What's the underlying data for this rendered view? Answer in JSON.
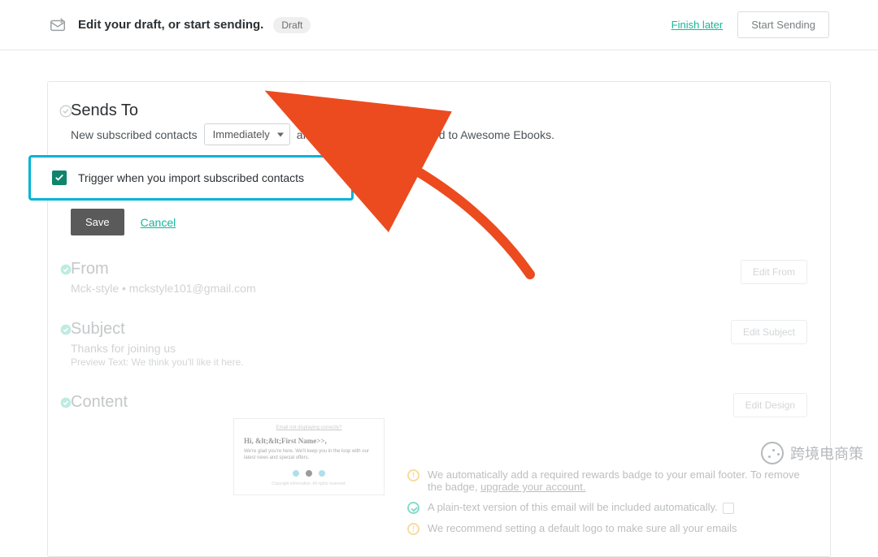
{
  "topbar": {
    "title": "Edit your draft, or start sending.",
    "badge": "Draft",
    "finish_later": "Finish later",
    "start_sending": "Start Sending"
  },
  "sends_to": {
    "title": "Sends To",
    "prefix": "New subscribed contacts",
    "select_value": "Immediately",
    "suffix": "after they join or are imported to Awesome Ebooks.",
    "checkbox_label": "Trigger when you import subscribed contacts",
    "checkbox_checked": true,
    "save": "Save",
    "cancel": "Cancel"
  },
  "from": {
    "title": "From",
    "value": "Mck-style • mckstyle101@gmail.com",
    "edit": "Edit From"
  },
  "subject": {
    "title": "Subject",
    "value": "Thanks for joining us",
    "preview": "Preview Text: We think you'll like it here.",
    "edit": "Edit Subject"
  },
  "content": {
    "title": "Content",
    "edit": "Edit Design",
    "preview": {
      "header_link": "Email not displaying correctly?",
      "greeting": "Hi, &lt;&lt;First Name>>,",
      "body": "We're glad you're here. We'll keep you in the loop with our latest news and special offers.",
      "footer": "Copyright information. All rights reserved."
    },
    "notes": {
      "n1_a": "We automatically add a required rewards badge to your email footer. To remove the badge, ",
      "n1_link": "upgrade your account.",
      "n2": "A plain-text version of this email will be included automatically.",
      "n3": "We recommend setting a default logo to make sure all your emails"
    }
  },
  "watermark": "跨境电商策"
}
